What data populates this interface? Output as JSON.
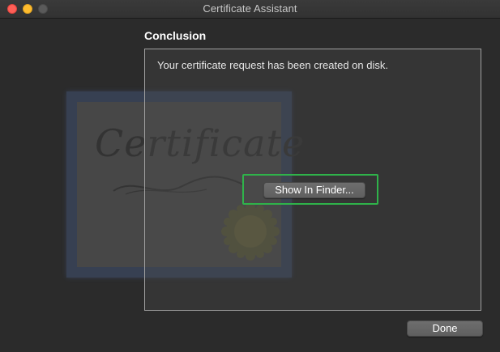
{
  "window": {
    "title": "Certificate Assistant",
    "controls": [
      "close",
      "minimize",
      "zoom"
    ]
  },
  "background_art": {
    "icon": "certificate-icon",
    "word": "Certificate"
  },
  "section": {
    "title": "Conclusion"
  },
  "content": {
    "message": "Your certificate request has been created on disk.",
    "show_in_finder_label": "Show In Finder..."
  },
  "footer": {
    "done_label": "Done"
  },
  "colors": {
    "highlight": "#2fb34a",
    "close": "#fe5f57",
    "minimize": "#febc2e"
  }
}
